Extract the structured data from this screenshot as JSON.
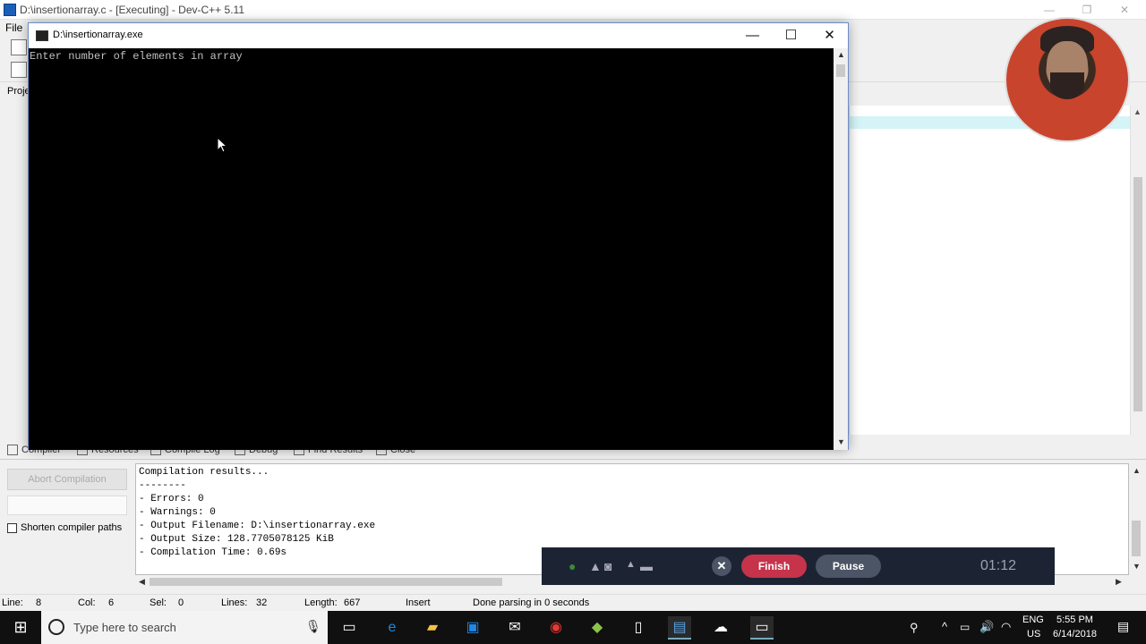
{
  "ide": {
    "title": "D:\\insertionarray.c - [Executing] - Dev-C++ 5.11",
    "menu_first": "File",
    "side_label": "Proje"
  },
  "console": {
    "title": "D:\\insertionarray.exe",
    "output": "Enter number of elements in array"
  },
  "bottom_tabs": [
    "Compiler",
    "Resources",
    "Compile Log",
    "Debug",
    "Find Results",
    "Close"
  ],
  "left_panel": {
    "abort_label": "Abort Compilation",
    "shorten_label": "Shorten compiler paths"
  },
  "compile_log": [
    "Compilation results...",
    "--------",
    "- Errors: 0",
    "- Warnings: 0",
    "- Output Filename: D:\\insertionarray.exe",
    "- Output Size: 128.7705078125 KiB",
    "- Compilation Time: 0.69s"
  ],
  "status": {
    "line_label": "Line:",
    "line": "8",
    "col_label": "Col:",
    "col": "6",
    "sel_label": "Sel:",
    "sel": "0",
    "lines_label": "Lines:",
    "lines": "32",
    "length_label": "Length:",
    "length": "667",
    "mode": "Insert",
    "message": "Done parsing in 0 seconds"
  },
  "recorder": {
    "finish_label": "Finish",
    "pause_label": "Pause",
    "elapsed": "01:12"
  },
  "taskbar": {
    "search_placeholder": "Type here to search",
    "lang": "ENG",
    "region": "US",
    "time": "5:55 PM",
    "date": "6/14/2018"
  }
}
